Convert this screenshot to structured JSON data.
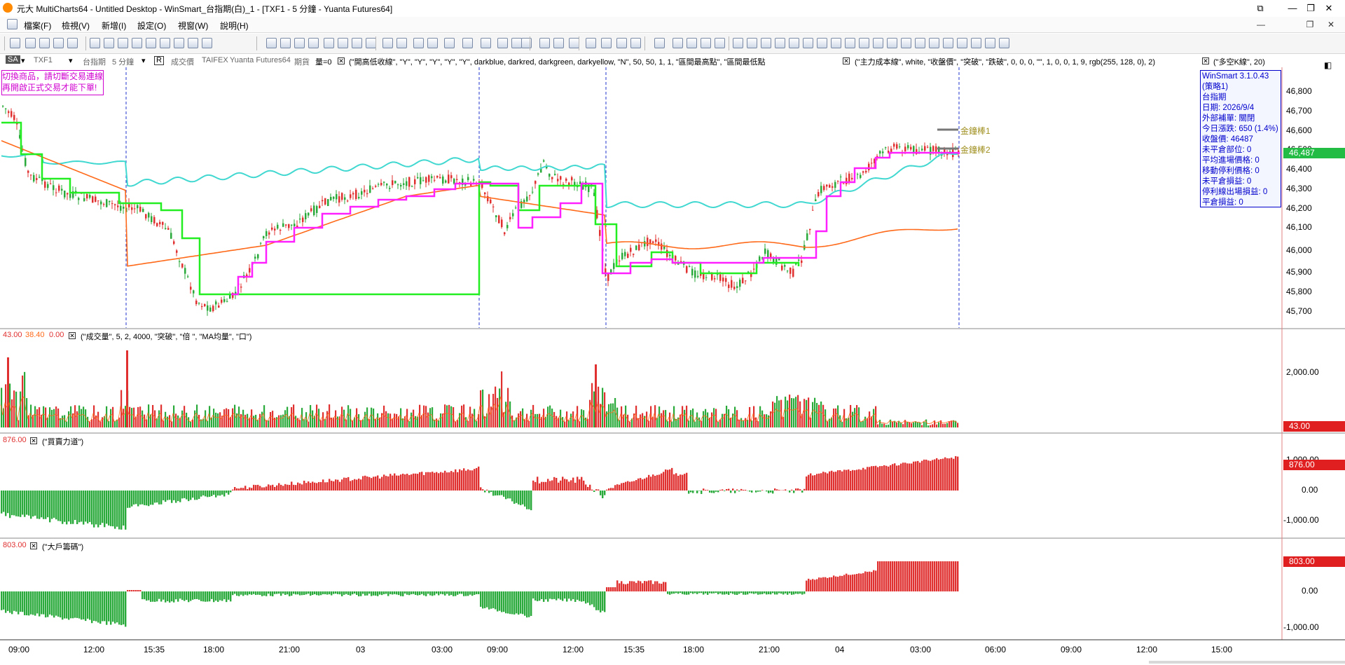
{
  "window": {
    "title": "元大 MultiCharts64 - Untitled Desktop - WinSmart_台指期(白)_1 - [TXF1 - 5 分鐘 - Yuanta Futures64]",
    "app_icon": "multicharts-logo-icon"
  },
  "menu": [
    {
      "label": "檔案(F)"
    },
    {
      "label": "檢視(V)"
    },
    {
      "label": "新增(I)"
    },
    {
      "label": "設定(O)"
    },
    {
      "label": "視窗(W)"
    },
    {
      "label": "說明(H)"
    }
  ],
  "symbol_bar": {
    "mode": "SA",
    "symbol": "TXF1",
    "name": "台指期",
    "interval": "5 分鐘",
    "r_label": "R",
    "field": "成交價",
    "exchange": "TAIFEX",
    "feed": "Yuanta Futures64",
    "type": "期貨",
    "vol": "量=0",
    "study1": "(\"開高低收線\", \"Y\", \"Y\", \"Y\", \"Y\", \"Y\", darkblue, darkred, darkgreen, darkyellow, \"N\", 50, 50, 1, 1, \"區間最高點\", \"區間最低點",
    "study2": "(\"主力成本線\", white, \"收盤價\", \"突破\", \"跌破\", 0, 0, 0, \"\", 1, 0, 0, 1, 9, rgb(255, 128, 0), 2)",
    "study3": "(\"多空K線\", 20)"
  },
  "warning": {
    "line1": "切換商品，請切斷交易連線",
    "line2": "再開啟正式交易才能下單!"
  },
  "info_box": {
    "version": "WinSmart 3.1.0.43",
    "strategy": "(策略1)",
    "product": "台指期",
    "date": "日期: 2026/9/4",
    "ext": "外部補單: 關閉",
    "change": "今日漲跌: 650 (1.4%)",
    "close": "收盤價: 46487",
    "open_pos": "未平倉部位: 0",
    "avg_entry": "平均進場價格: 0",
    "trail_stop": "移動停利價格: 0",
    "unrealized": "未平倉損益: 0",
    "stop_exit": "停利線出場損益: 0",
    "realized": "平倉損益: 0"
  },
  "gold_lines": {
    "line1": "金鐘棒1",
    "line2": "金鐘棒2"
  },
  "price_pane": {
    "axis": [
      "46,800",
      "46,700",
      "46,600",
      "46,500",
      "46,400",
      "46,300",
      "46,200",
      "46,100",
      "46,000",
      "45,900",
      "45,800",
      "45,700"
    ],
    "last_price": "46,487"
  },
  "volume_pane": {
    "values": {
      "v1": "43.00",
      "v2": "38.40",
      "v3": "0.00"
    },
    "study": "(\"成交量\", 5, 2, 4000, \"突破\", \"倍 \", \"MA均量\", \"口\")",
    "axis": [
      "2,000.00"
    ],
    "last": "43.00"
  },
  "buysell_pane": {
    "value": "876.00",
    "study": "(\"買賣力道\")",
    "axis": [
      "1,000.00",
      "0.00",
      "-1,000.00"
    ],
    "last": "876.00"
  },
  "whale_pane": {
    "value": "803.00",
    "study": "(\"大戶籌碼\")",
    "axis": [
      "0.00",
      "-1,000.00"
    ],
    "last": "803.00"
  },
  "time_axis": [
    "09:00",
    "12:00",
    "15:35",
    "18:00",
    "21:00",
    "03",
    "03:00",
    "09:00",
    "12:00",
    "15:35",
    "18:00",
    "21:00",
    "04",
    "03:00",
    "06:00",
    "09:00",
    "12:00",
    "15:00"
  ],
  "colors": {
    "red": "#e03030",
    "green": "#2aaa3a",
    "cyan": "#40d8d0",
    "orange": "#ff6a1a",
    "magenta": "#ff20ff",
    "lime": "#22ee22",
    "last_tag": "#e02020",
    "price_tag": "#22bb44"
  }
}
